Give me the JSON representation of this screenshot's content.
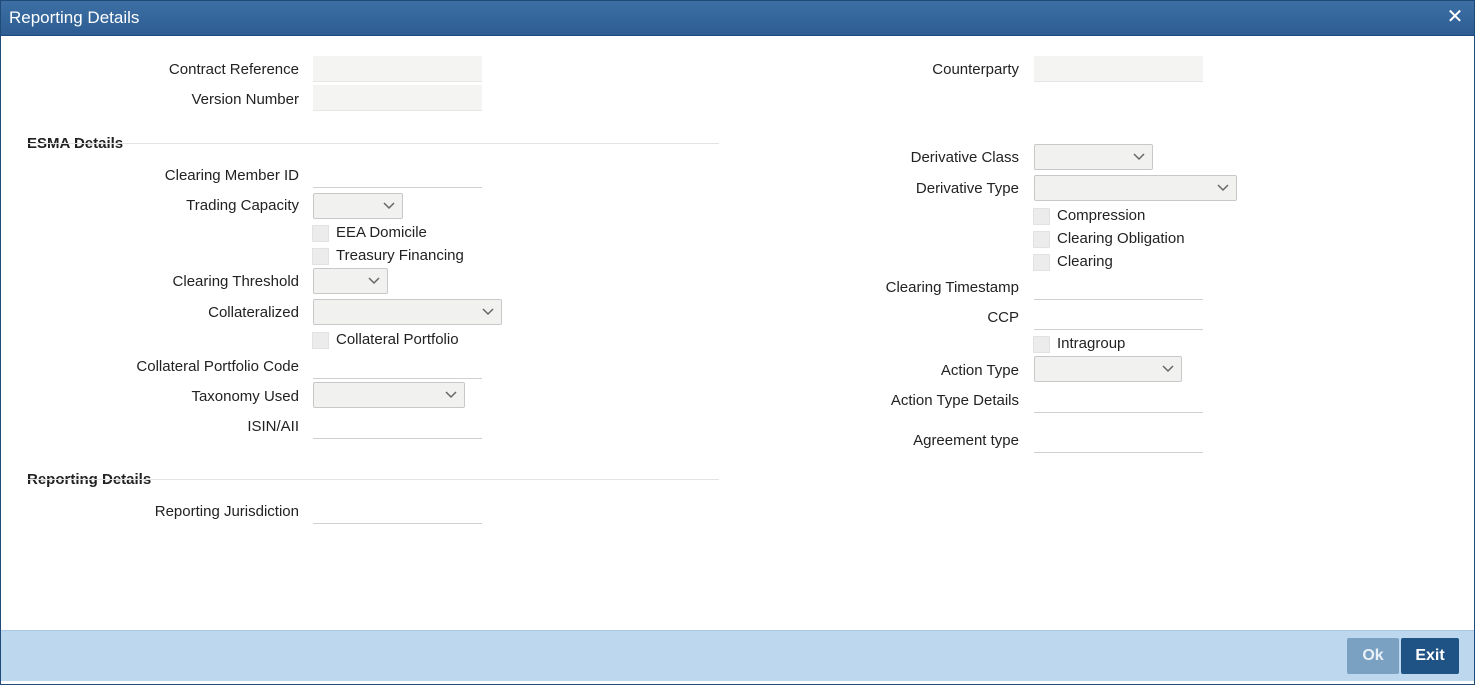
{
  "window": {
    "title": "Reporting Details",
    "close_glyph": "✕"
  },
  "header": {
    "contract_reference_label": "Contract Reference",
    "version_number_label": "Version Number",
    "counterparty_label": "Counterparty",
    "contract_reference_value": "",
    "version_number_value": "",
    "counterparty_value": ""
  },
  "esma": {
    "section_title": "ESMA Details",
    "clearing_member_id_label": "Clearing Member ID",
    "trading_capacity_label": "Trading Capacity",
    "eea_domicile_label": "EEA Domicile",
    "treasury_financing_label": "Treasury Financing",
    "clearing_threshold_label": "Clearing Threshold",
    "collateralized_label": "Collateralized",
    "collateral_portfolio_label": "Collateral Portfolio",
    "collateral_portfolio_code_label": "Collateral Portfolio Code",
    "taxonomy_used_label": "Taxonomy Used",
    "isin_all_label": "ISIN/AII",
    "derivative_class_label": "Derivative Class",
    "derivative_type_label": "Derivative Type",
    "compression_label": "Compression",
    "clearing_obligation_label": "Clearing Obligation",
    "clearing_label": "Clearing",
    "clearing_timestamp_label": "Clearing Timestamp",
    "ccp_label": "CCP",
    "intragroup_label": "Intragroup",
    "action_type_label": "Action Type",
    "action_type_details_label": "Action Type Details",
    "agreement_type_label": "Agreement type"
  },
  "reporting": {
    "section_title": "Reporting Details",
    "reporting_jurisdiction_label": "Reporting Jurisdiction"
  },
  "footer": {
    "ok_label": "Ok",
    "exit_label": "Exit"
  },
  "icons": {
    "close": "close-icon",
    "dropdown": "chevron-down-icon"
  },
  "colors": {
    "titlebar": "#2d5d92",
    "footer": "#bdd7ee",
    "exit_button": "#1f5385",
    "ok_button_disabled": "#7aa0c2"
  }
}
